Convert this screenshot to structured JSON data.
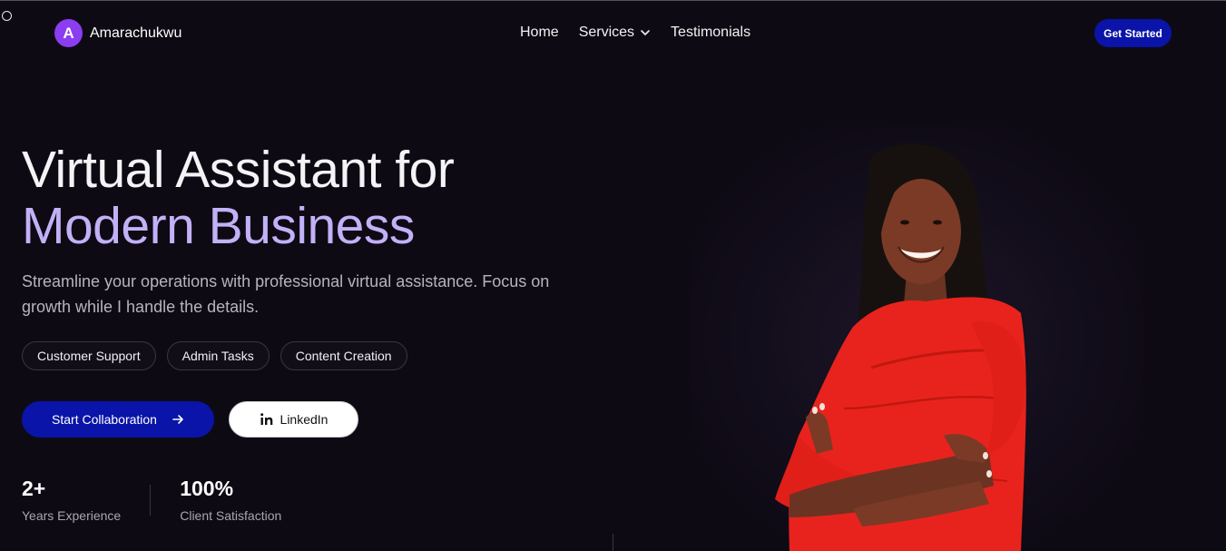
{
  "brand": {
    "initial": "A",
    "name": "Amarachukwu"
  },
  "nav": {
    "home": "Home",
    "services": "Services",
    "testimonials": "Testimonials"
  },
  "header": {
    "cta_label": "Get Started"
  },
  "hero": {
    "title_line1": "Virtual Assistant for",
    "title_line2": "Modern Business",
    "subtitle": "Streamline your operations with professional virtual assistance. Focus on growth while I handle the details.",
    "tags": [
      "Customer Support",
      "Admin Tasks",
      "Content Creation"
    ],
    "primary_button": "Start Collaboration",
    "secondary_button": "LinkedIn"
  },
  "stats": [
    {
      "value": "2+",
      "label": "Years Experience"
    },
    {
      "value": "100%",
      "label": "Client Satisfaction"
    }
  ],
  "colors": {
    "background": "#0e0a14",
    "accent_blue": "#0a14a8",
    "accent_lavender": "#c2b1f7",
    "avatar_purple": "#8b3df0",
    "dress_red": "#e8231d"
  },
  "icons": {
    "chevron": "chevron-down-icon",
    "arrow": "arrow-right-icon",
    "linkedin": "linkedin-icon"
  }
}
